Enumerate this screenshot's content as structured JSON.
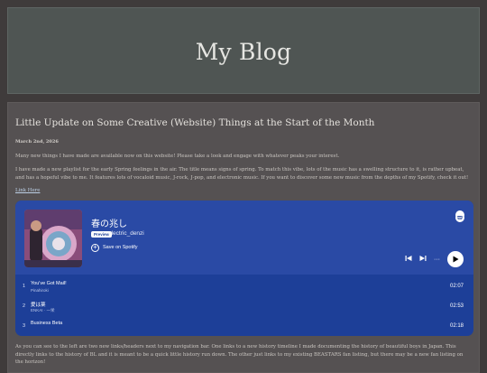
{
  "header": {
    "blog_title": "My Blog"
  },
  "post": {
    "title": "Little Update on Some Creative (Website) Things at the Start of the Month",
    "date": "March 2nd, 2026",
    "paragraph1": "Many new things I have made are available now on this website! Please take a look and engage with whatever peaks your interest.",
    "paragraph2": "I have made a new playlist for the early Spring feelings in the air. The title means signs of spring. To match this vibe, lots of the music has a swelling structure to it, is rather upbeat, and has a hopeful vibe to me. It features lots of vocaloid music, J-rock, J-pop, and electronic music. If you want to discover some new music from the depths of my Spotify, check it out!",
    "link_text": "Link Here",
    "paragraph3": "As you can see to the left are two new links/headers next to my navigation bar. One links to a new history timeline I made documenting the history of beautiful boys in Japan. This directly links to the history of BL and it is meant to be a quick little history run down. The other just links to my existing BEASTARS fan listing, but there may be a new fan listing on the horizon!"
  },
  "embed": {
    "track_title": "春の兆し",
    "preview_label": "Preview",
    "artist": "electric_denzi",
    "save_label": "Save on Spotify",
    "icons": {
      "spotify": "spotify-logo-icon",
      "skip_back": "skip-back-icon",
      "skip_forward": "skip-forward-icon",
      "more": "more-icon",
      "play": "play-icon",
      "plus": "plus-circle-icon"
    },
    "more_symbol": "···",
    "tracks": [
      {
        "num": "1",
        "name": "You've Got Mail!",
        "artist": "Pinahiroki",
        "duration": "02:07"
      },
      {
        "num": "2",
        "name": "愛は薬",
        "artist": "ENKAI · 一栄",
        "duration": "02:53"
      },
      {
        "num": "3",
        "name": "Business Beta",
        "artist": "",
        "duration": "02:18"
      }
    ],
    "colors": {
      "background": "#1d3f98",
      "top": "#2a4aa5"
    }
  },
  "colors": {
    "page_bg": "#3f3b3b",
    "header_bg": "#4f5553",
    "post_bg": "#555152"
  }
}
